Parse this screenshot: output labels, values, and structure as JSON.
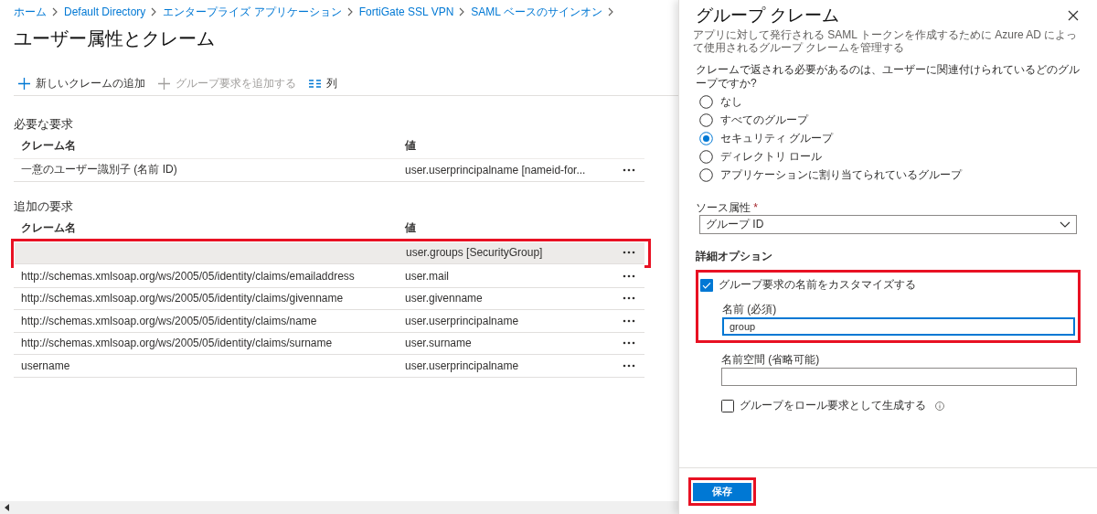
{
  "breadcrumb": [
    {
      "label": "ホーム"
    },
    {
      "label": "Default Directory"
    },
    {
      "label": "エンタープライズ アプリケーション"
    },
    {
      "label": "FortiGate SSL VPN"
    },
    {
      "label": "SAML ベースのサインオン"
    }
  ],
  "page_title": "ユーザー属性とクレーム",
  "toolbar": [
    {
      "label": "新しいクレームの追加",
      "kind": "add",
      "disabled": false
    },
    {
      "label": "グループ要求を追加する",
      "kind": "add",
      "disabled": true
    },
    {
      "label": "列",
      "kind": "columns",
      "disabled": false
    }
  ],
  "sections": [
    {
      "title": "必要な要求",
      "columns": [
        "クレーム名",
        "値"
      ],
      "rows": [
        {
          "name": "一意のユーザー識別子 (名前 ID)",
          "value": "user.userprincipalname [nameid-for...",
          "selected": false,
          "highlighted": false
        }
      ]
    },
    {
      "title": "追加の要求",
      "columns": [
        "クレーム名",
        "値"
      ],
      "rows": [
        {
          "value": "user.groups [SecurityGroup]",
          "selected": true,
          "highlighted": true
        },
        {
          "name": "http://schemas.xmlsoap.org/ws/2005/05/identity/claims/emailaddress",
          "value": "user.mail",
          "selected": false,
          "highlighted": false
        },
        {
          "name": "http://schemas.xmlsoap.org/ws/2005/05/identity/claims/givenname",
          "value": "user.givenname",
          "selected": false,
          "highlighted": false
        },
        {
          "name": "http://schemas.xmlsoap.org/ws/2005/05/identity/claims/name",
          "value": "user.userprincipalname",
          "selected": false,
          "highlighted": false
        },
        {
          "name": "http://schemas.xmlsoap.org/ws/2005/05/identity/claims/surname",
          "value": "user.surname",
          "selected": false,
          "highlighted": false
        },
        {
          "name": "username",
          "value": "user.userprincipalname",
          "selected": false,
          "highlighted": false
        }
      ]
    }
  ],
  "panel": {
    "title": "グループ クレーム",
    "subtitle": "アプリに対して発行される SAML トークンを作成するために Azure AD によって使用されるグループ クレームを管理する",
    "question": "クレームで返される必要があるのは、ユーザーに関連付けられているどのグループですか?",
    "options": [
      {
        "label": "なし",
        "selected": false
      },
      {
        "label": "すべてのグループ",
        "selected": false
      },
      {
        "label": "セキュリティ グループ",
        "selected": true
      },
      {
        "label": "ディレクトリ ロール",
        "selected": false
      },
      {
        "label": "アプリケーションに割り当てられているグループ",
        "selected": false
      }
    ],
    "source_label": "ソース属性",
    "required_mark": "*",
    "source_value": "グループ ID",
    "advanced_title": "詳細オプション",
    "customize": {
      "label": "グループ要求の名前をカスタマイズする",
      "checked": true,
      "highlighted": true,
      "name_label": "名前 (必須)",
      "name_value": "group"
    },
    "namespace_label": "名前空間 (省略可能)",
    "role": {
      "label": "グループをロール要求として生成する",
      "checked": false
    },
    "save": {
      "label": "保存",
      "highlighted": true
    }
  }
}
